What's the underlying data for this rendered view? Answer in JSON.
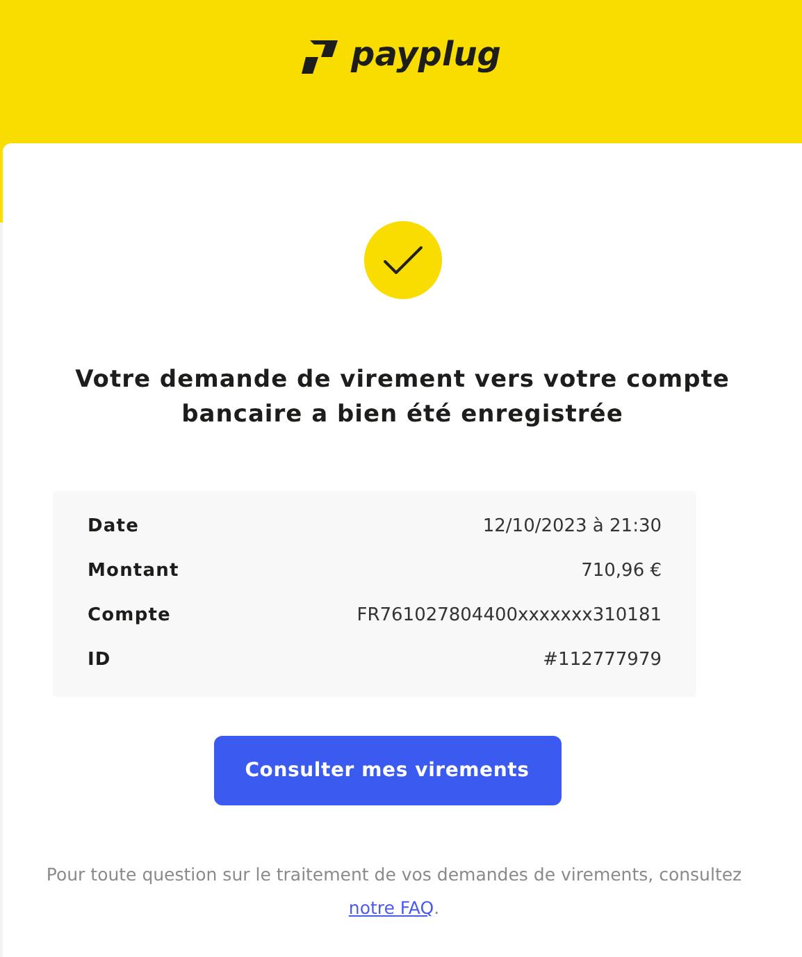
{
  "header": {
    "brand": "payplug"
  },
  "title": "Votre demande de virement vers votre compte bancaire a bien été enregistrée",
  "details": [
    {
      "label": "Date",
      "value": "12/10/2023 à 21:30"
    },
    {
      "label": "Montant",
      "value": "710,96 €"
    },
    {
      "label": "Compte",
      "value": "FR761027804400xxxxxxx310181"
    },
    {
      "label": "ID",
      "value": "#112777979"
    }
  ],
  "button": "Consulter mes virements",
  "footer": {
    "text": "Pour toute question sur le traitement de vos demandes de virements, consultez",
    "link": "notre FAQ",
    "after": "."
  }
}
